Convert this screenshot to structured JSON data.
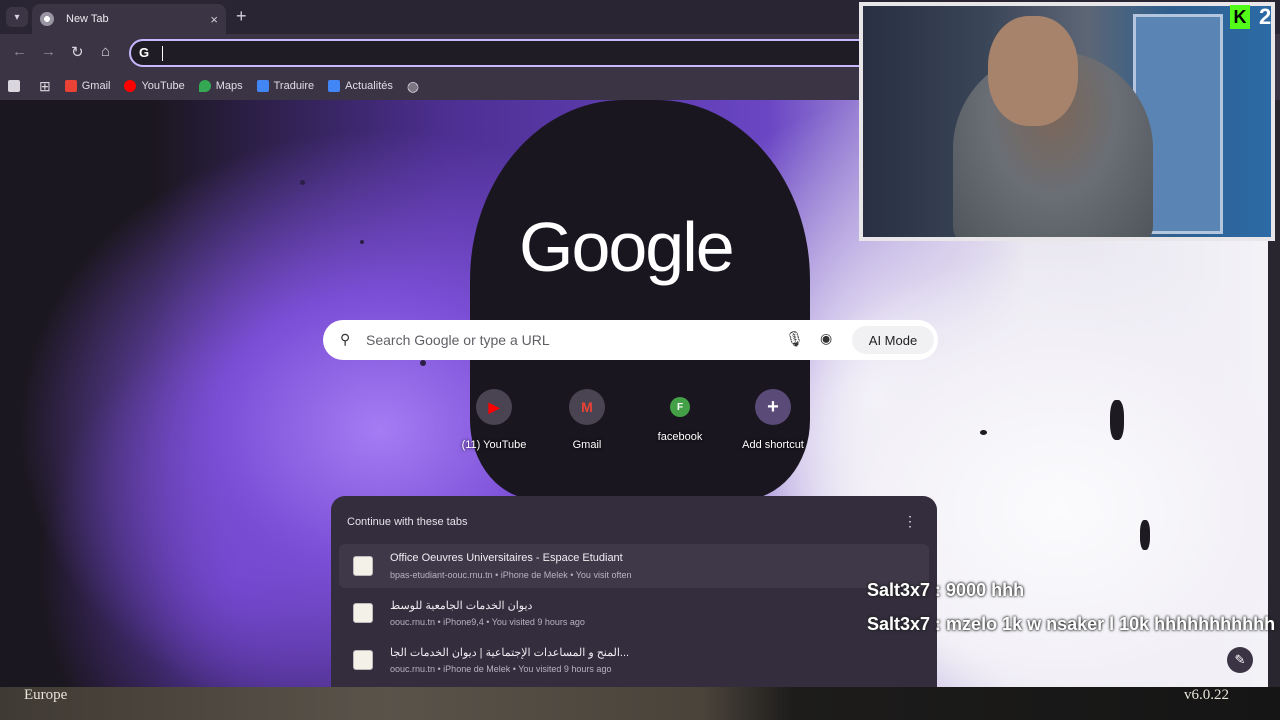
{
  "browser": {
    "tab_title": "New Tab",
    "tab_close_icon": "×",
    "new_tab_icon": "+",
    "omnibox_g": "G",
    "bookmarks": [
      {
        "label": "Gmail",
        "icon": "gmail-icon",
        "color": "#ea4335"
      },
      {
        "label": "YouTube",
        "icon": "youtube-icon",
        "color": "#ff0000"
      },
      {
        "label": "Maps",
        "icon": "maps-icon",
        "color": "#34a853"
      },
      {
        "label": "Traduire",
        "icon": "translate-icon",
        "color": "#4285f4"
      },
      {
        "label": "Actualités",
        "icon": "news-icon",
        "color": "#4285f4"
      }
    ]
  },
  "ntp": {
    "logo": "Google",
    "search_placeholder": "Search Google or type a URL",
    "ai_mode": "AI Mode",
    "shortcuts": [
      {
        "label": "(11) YouTube",
        "glyph": "▶",
        "color": "#ff0000"
      },
      {
        "label": "Gmail",
        "glyph": "M",
        "color": "#ea4335"
      },
      {
        "label": "facebook",
        "glyph": "F",
        "color": "#43a047"
      },
      {
        "label": "Add shortcut",
        "glyph": "+",
        "color": "#ffffff"
      }
    ],
    "continue": {
      "title": "Continue with these tabs",
      "tabs": [
        {
          "title": "Office Oeuvres Universitaires - Espace Etudiant",
          "sub": "bpas-etudiant-oouc.rnu.tn • iPhone de Melek • You visit often"
        },
        {
          "title": "ديوان الخدمات الجامعية للوسط",
          "sub": "oouc.rnu.tn • iPhone9,4 • You visited 9 hours ago"
        },
        {
          "title": "المنح و المساعدات الإجتماعية | ديوان الخدمات الجا...",
          "sub": "oouc.rnu.tn • iPhone de Melek • You visited 9 hours ago"
        }
      ]
    }
  },
  "overlay": {
    "kick_logo": "K",
    "viewer_count": "2",
    "chat": [
      {
        "user": "Salt3x7",
        "message": "9000 hhh"
      },
      {
        "user": "Salt3x7",
        "message": "mzelo 1k w nsaker l 10k hhhhhhhhhhh"
      }
    ],
    "bottom_left": "Europe",
    "bottom_right": "v6.0.22"
  }
}
